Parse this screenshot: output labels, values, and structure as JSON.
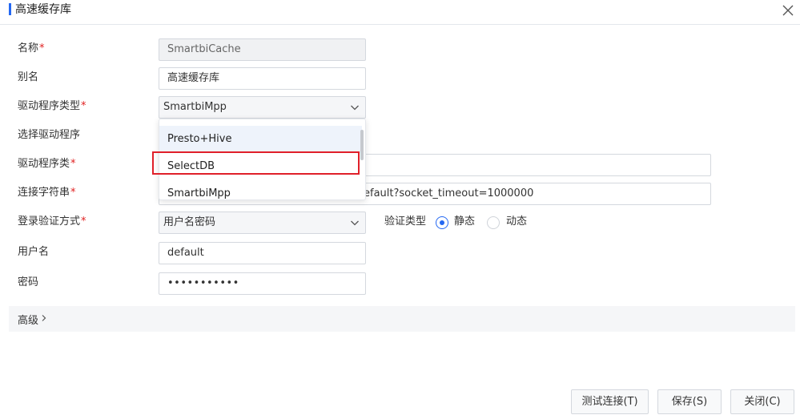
{
  "dialog": {
    "title": "高速缓存库"
  },
  "form": {
    "name": {
      "label": "名称",
      "value": "SmartbiCache"
    },
    "alias": {
      "label": "别名",
      "value": "高速缓存库"
    },
    "driver_type": {
      "label": "驱动程序类型",
      "value": "SmartbiMpp"
    },
    "select_driver": {
      "label": "选择驱动程序"
    },
    "driver_class": {
      "label": "驱动程序类"
    },
    "conn_string": {
      "label": "连接字符串",
      "value": "efault?socket_timeout=1000000"
    },
    "auth_method": {
      "label": "登录验证方式",
      "value": "用户名密码"
    },
    "verify_type": {
      "label": "验证类型",
      "options": [
        "静态",
        "动态"
      ],
      "selected": "静态"
    },
    "username": {
      "label": "用户名",
      "value": "default"
    },
    "password": {
      "label": "密码",
      "value": "•••••••••••"
    }
  },
  "required_mark": "*",
  "dropdown": {
    "options": [
      "Presto+Hive",
      "SelectDB",
      "SmartbiMpp"
    ],
    "highlighted": "SelectDB"
  },
  "advanced": {
    "label": "高级"
  },
  "buttons": {
    "test": "测试连接(T)",
    "save": "保存(S)",
    "close": "关闭(C)"
  },
  "colors": {
    "accent": "#2468f2",
    "required": "#e02020",
    "highlight_border": "#e0202a"
  }
}
